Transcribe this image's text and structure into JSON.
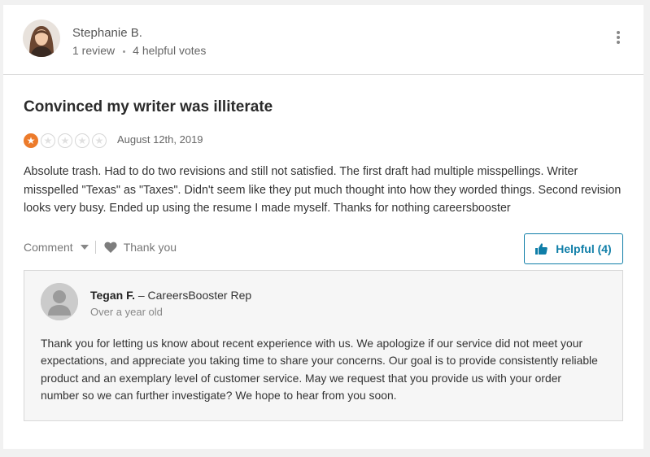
{
  "reviewer": {
    "name": "Stephanie B.",
    "reviews": "1 review",
    "helpful_votes": "4 helpful votes"
  },
  "review": {
    "title": "Convinced my writer was illiterate",
    "rating": 1,
    "rating_max": 5,
    "date": "August 12th, 2019",
    "body": "Absolute trash. Had to do two revisions and still not satisfied. The first draft had multiple misspellings. Writer misspelled \"Texas\" as \"Taxes\". Didn't seem like they put much thought into how they worded things. Second revision looks very busy. Ended up using the resume I made myself. Thanks for nothing careersbooster"
  },
  "actions": {
    "comment_label": "Comment",
    "thank_label": "Thank you",
    "helpful_label": "Helpful (4)"
  },
  "reply": {
    "name": "Tegan F.",
    "role": " – CareersBooster Rep",
    "time": "Over a year old",
    "body": "Thank you for letting us know about recent experience with us. We apologize if our service did not meet your expectations, and appreciate you taking time to share your concerns. Our goal is to provide consistently reliable product and an exemplary level of customer service. May we request that you provide us with your order number so we can further investigate? We hope to hear from you soon."
  },
  "colors": {
    "accent": "#0f7ea8",
    "star_filled": "#ec7b2b"
  },
  "icons": {
    "more": "more-vertical-icon",
    "heart": "heart-icon",
    "thumb": "thumbs-up-icon",
    "caret": "chevron-down-icon"
  }
}
